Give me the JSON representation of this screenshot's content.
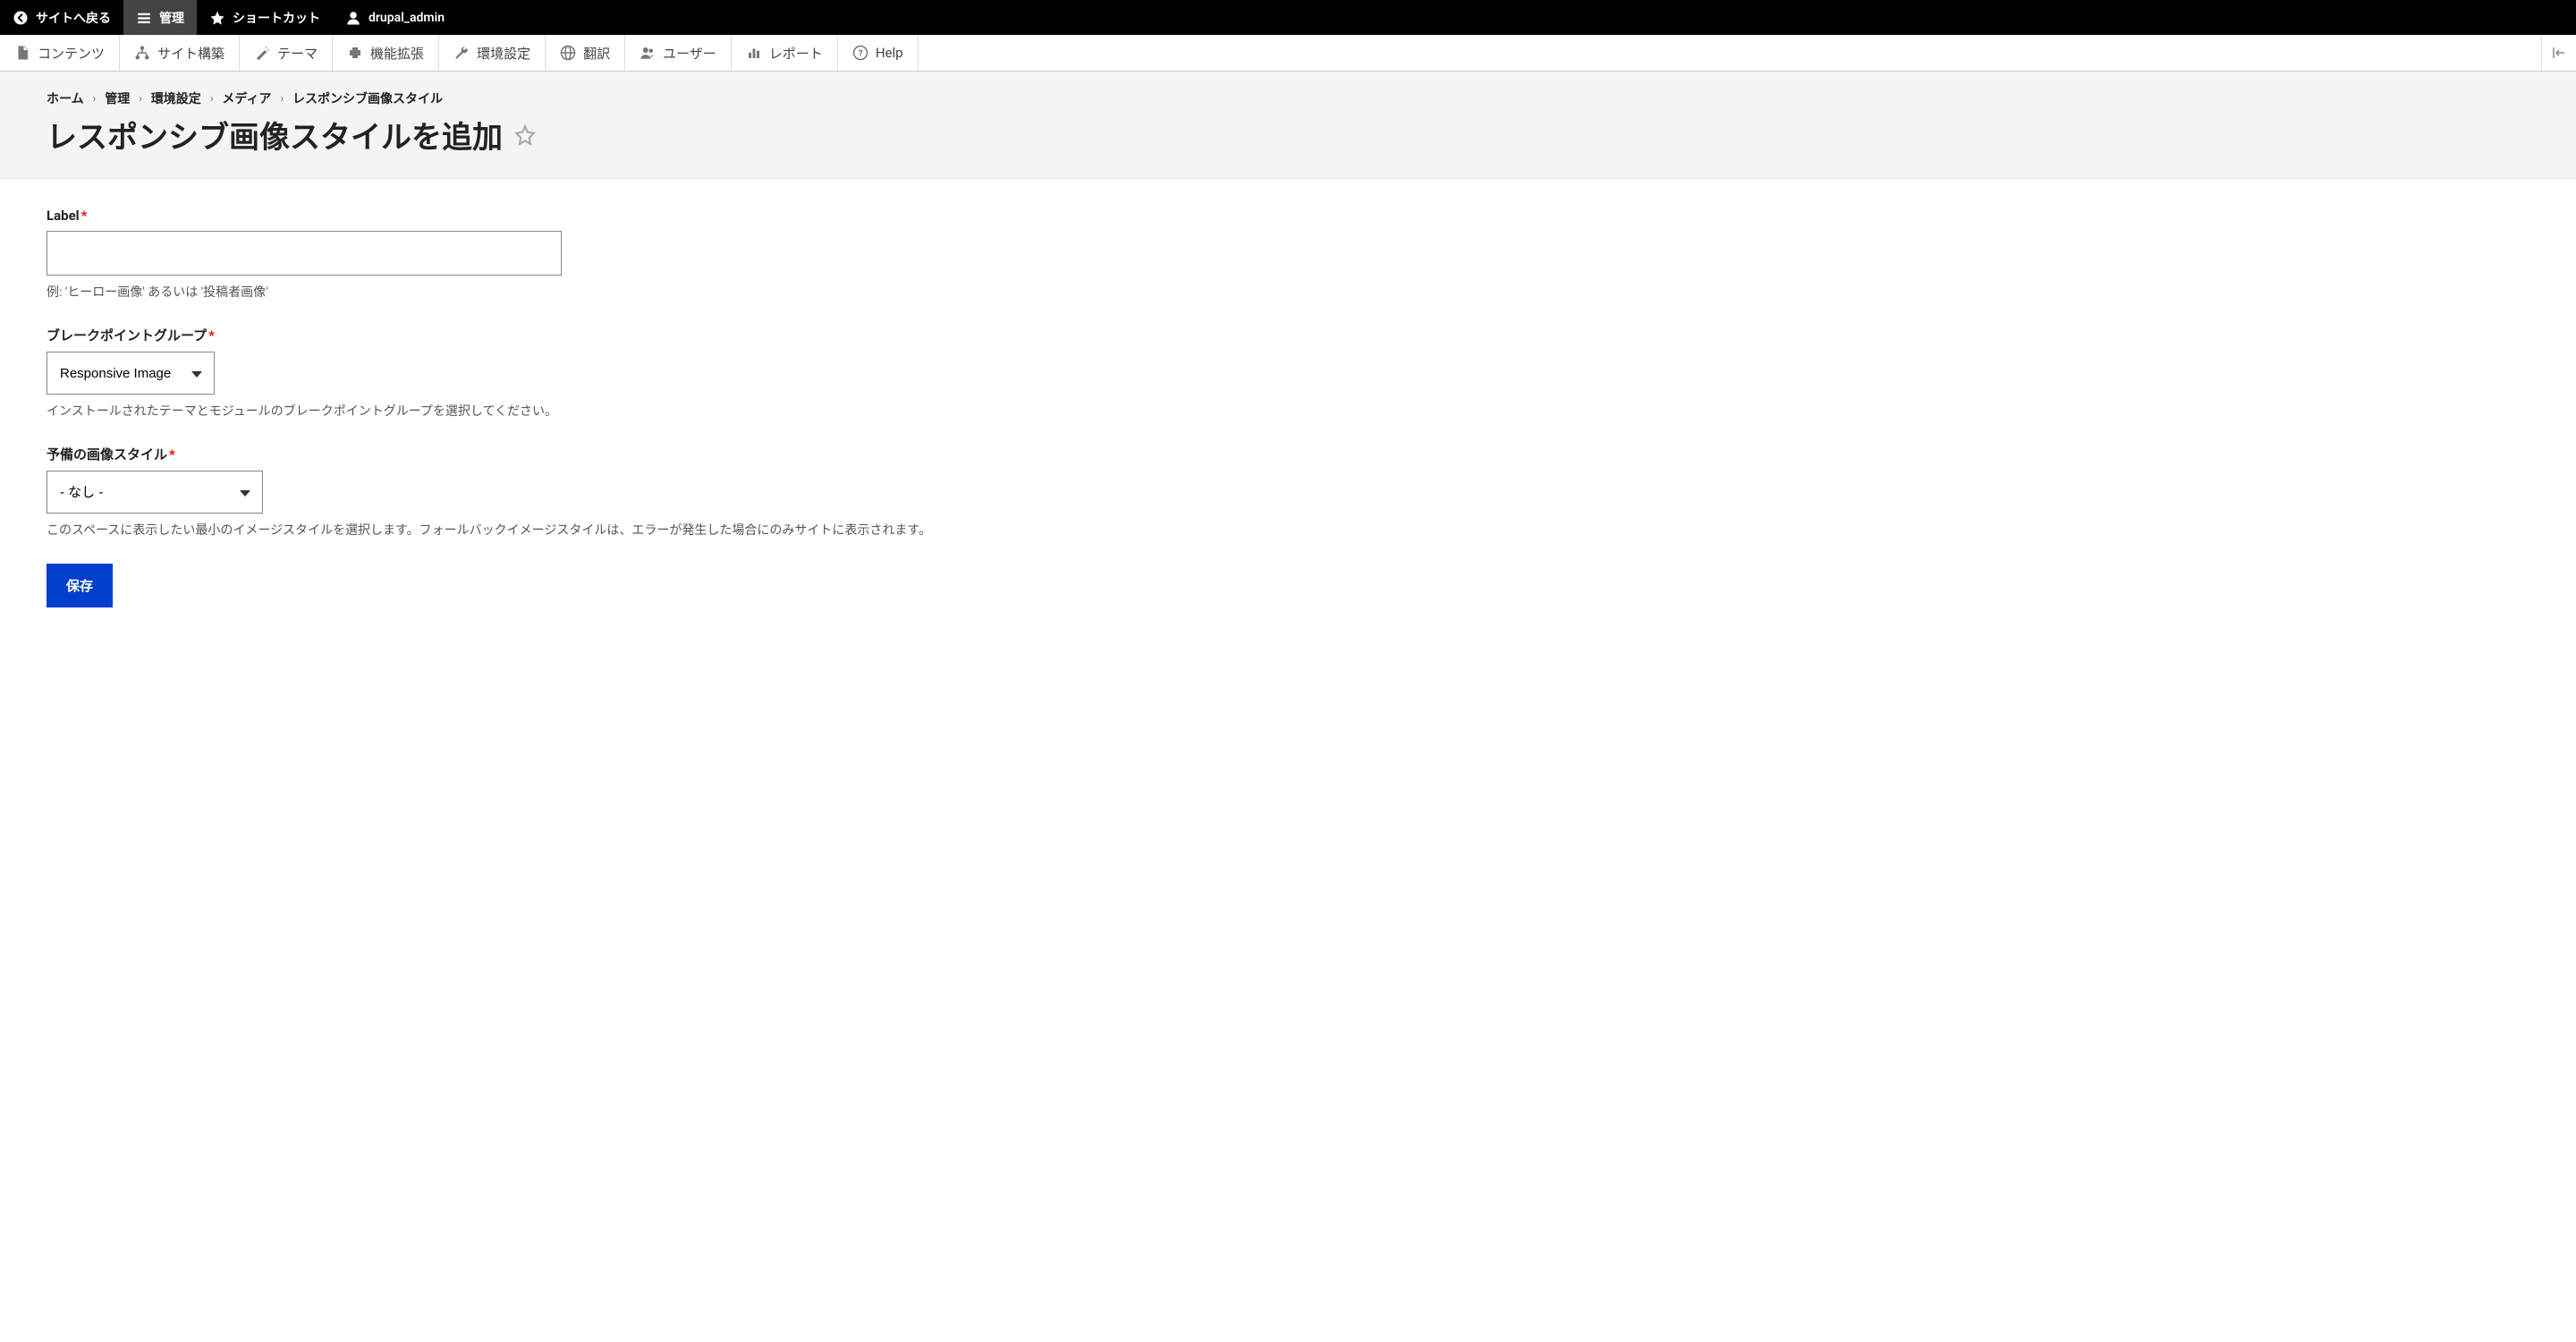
{
  "toolbar": {
    "back_to_site": "サイトへ戻る",
    "manage": "管理",
    "shortcuts": "ショートカット",
    "user": "drupal_admin"
  },
  "admin_menu": {
    "content": "コンテンツ",
    "structure": "サイト構築",
    "appearance": "テーマ",
    "extend": "機能拡張",
    "configuration": "環境設定",
    "translate": "翻訳",
    "people": "ユーザー",
    "reports": "レポート",
    "help": "Help"
  },
  "breadcrumb": {
    "home": "ホーム",
    "admin": "管理",
    "config": "環境設定",
    "media": "メディア",
    "current": "レスポンシブ画像スタイル"
  },
  "page_title": "レスポンシブ画像スタイルを追加",
  "form": {
    "label": {
      "label": "Label",
      "value": "",
      "description": "例: 'ヒーロー画像' あるいは '投稿者画像'"
    },
    "breakpoint_group": {
      "label": "ブレークポイントグループ",
      "value": "Responsive Image",
      "description": "インストールされたテーマとモジュールのブレークポイントグループを選択してください。"
    },
    "fallback_style": {
      "label": "予備の画像スタイル",
      "value": "- なし -",
      "description": "このスペースに表示したい最小のイメージスタイルを選択します。フォールバックイメージスタイルは、エラーが発生した場合にのみサイトに表示されます。"
    },
    "submit": "保存"
  }
}
